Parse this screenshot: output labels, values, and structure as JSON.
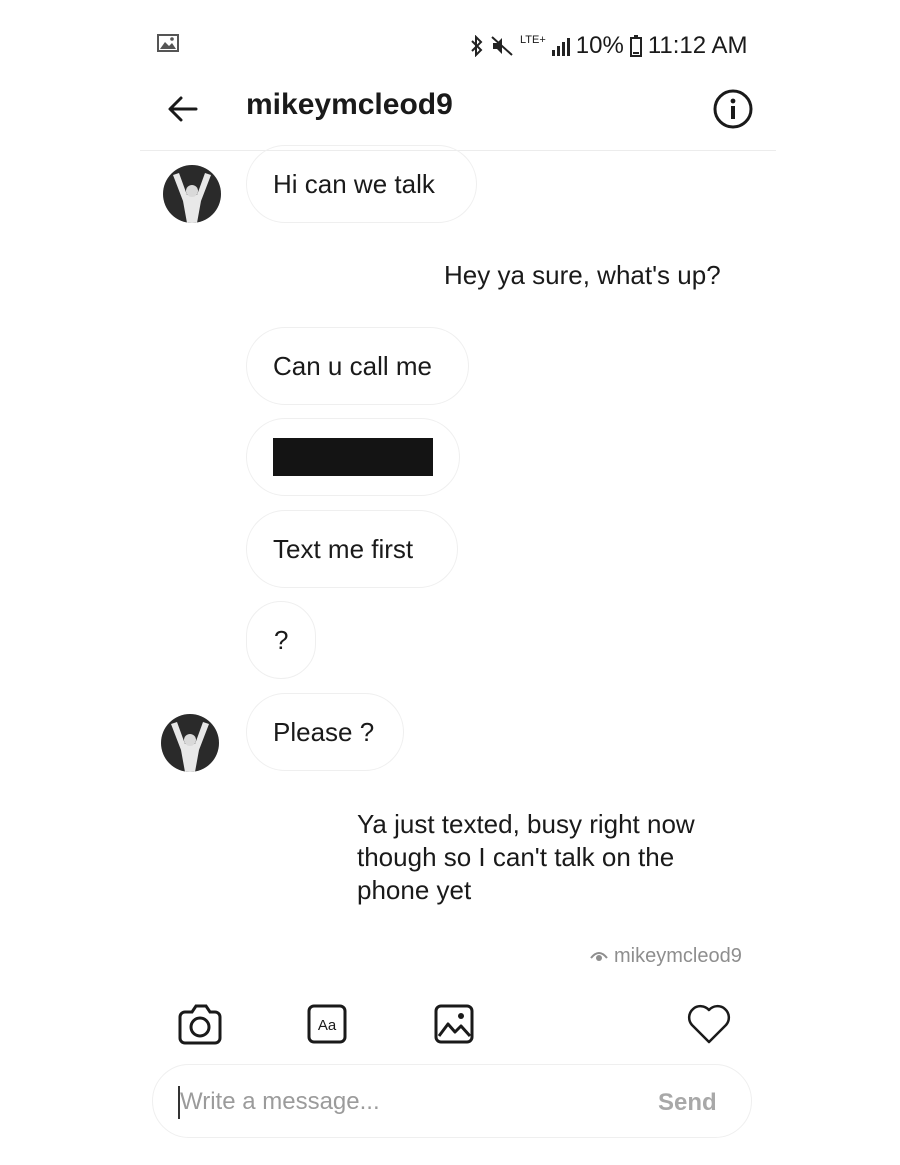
{
  "status_bar": {
    "network": "LTE+",
    "battery": "10%",
    "time": "11:12 AM",
    "icons": [
      "image-icon",
      "bluetooth-icon",
      "mute-icon",
      "signal-icon",
      "battery-icon"
    ]
  },
  "header": {
    "title": "mikeymcleod9",
    "back_icon": "arrow-left-icon",
    "info_icon": "info-circle-icon"
  },
  "messages": [
    {
      "from": "them",
      "text": "Hi can we talk",
      "avatar": true
    },
    {
      "from": "me",
      "text": "Hey ya sure, what's up?"
    },
    {
      "from": "them",
      "text": "Can u call me"
    },
    {
      "from": "them",
      "text": "",
      "redacted": true
    },
    {
      "from": "them",
      "text": "Text me first"
    },
    {
      "from": "them",
      "text": "?"
    },
    {
      "from": "them",
      "text": "Please ?",
      "avatar": true
    },
    {
      "from": "me",
      "lines": [
        "Ya just texted, busy right now",
        "though so I can't talk on the",
        "phone yet"
      ]
    }
  ],
  "seen_by": "mikeymcleod9",
  "toolbar": {
    "icons": [
      "camera-icon",
      "text-style-icon",
      "gallery-icon",
      "heart-icon"
    ],
    "text_icon_label": "Aa"
  },
  "composer": {
    "placeholder": "Write a message...",
    "value": "",
    "send_label": "Send"
  },
  "colors": {
    "text": "#1a1a1a",
    "bubble_border": "#efefef",
    "muted": "#8e8e8e",
    "send_disabled": "#a8a8a8"
  }
}
